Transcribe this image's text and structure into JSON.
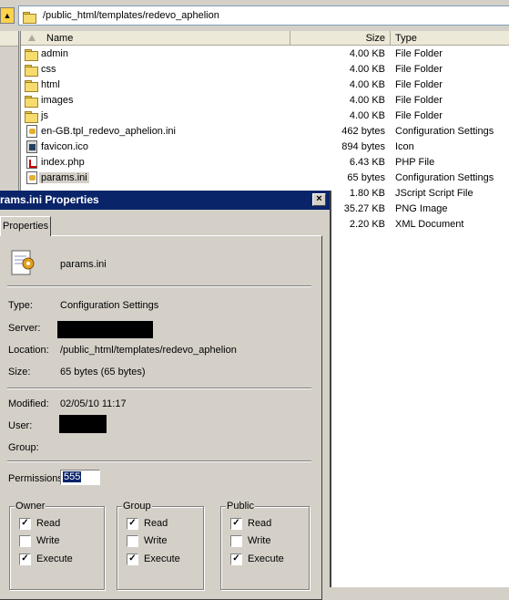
{
  "address_bar": {
    "path": "/public_html/templates/redevo_aphelion"
  },
  "file_list": {
    "columns": {
      "name": "Name",
      "size": "Size",
      "type": "Type"
    },
    "rows": [
      {
        "name": "admin",
        "size": "4.00 KB",
        "type": "File Folder",
        "icon": "folder-icon"
      },
      {
        "name": "css",
        "size": "4.00 KB",
        "type": "File Folder",
        "icon": "folder-icon"
      },
      {
        "name": "html",
        "size": "4.00 KB",
        "type": "File Folder",
        "icon": "folder-icon"
      },
      {
        "name": "images",
        "size": "4.00 KB",
        "type": "File Folder",
        "icon": "folder-icon"
      },
      {
        "name": "js",
        "size": "4.00 KB",
        "type": "File Folder",
        "icon": "folder-icon"
      },
      {
        "name": "en-GB.tpl_redevo_aphelion.ini",
        "size": "462 bytes",
        "type": "Configuration Settings",
        "icon": "ini-file-icon"
      },
      {
        "name": "favicon.ico",
        "size": "894 bytes",
        "type": "Icon",
        "icon": "ico-file-icon"
      },
      {
        "name": "index.php",
        "size": "6.43 KB",
        "type": "PHP File",
        "icon": "php-file-icon"
      },
      {
        "name": "params.ini",
        "size": "65 bytes",
        "type": "Configuration Settings",
        "icon": "ini-file-icon",
        "selected": true
      },
      {
        "name": "",
        "size": "1.80 KB",
        "type": "JScript Script File"
      },
      {
        "name": "",
        "size": "35.27 KB",
        "type": "PNG Image"
      },
      {
        "name": "",
        "size": "2.20 KB",
        "type": "XML Document"
      }
    ]
  },
  "dialog": {
    "title": "params.ini Properties",
    "close_label": "×",
    "tab": "Properties",
    "file_name": "params.ini",
    "type_label": "Type:",
    "type_value": "Configuration Settings",
    "server_label": "Server:",
    "location_label": "Location:",
    "location_value": "/public_html/templates/redevo_aphelion",
    "size_label": "Size:",
    "size_value": "65 bytes (65 bytes)",
    "modified_label": "Modified:",
    "modified_value": "02/05/10 11:17",
    "user_label": "User:",
    "group_label": "Group:",
    "permissions_label": "Permissions:",
    "permissions_value": "555",
    "groups": [
      {
        "title": "Owner",
        "read": "Read",
        "write": "Write",
        "execute": "Execute",
        "read_checked": true,
        "write_checked": false,
        "execute_checked": true
      },
      {
        "title": "Group",
        "read": "Read",
        "write": "Write",
        "execute": "Execute",
        "read_checked": true,
        "write_checked": false,
        "execute_checked": true
      },
      {
        "title": "Public",
        "read": "Read",
        "write": "Write",
        "execute": "Execute",
        "read_checked": true,
        "write_checked": false,
        "execute_checked": true
      }
    ]
  }
}
